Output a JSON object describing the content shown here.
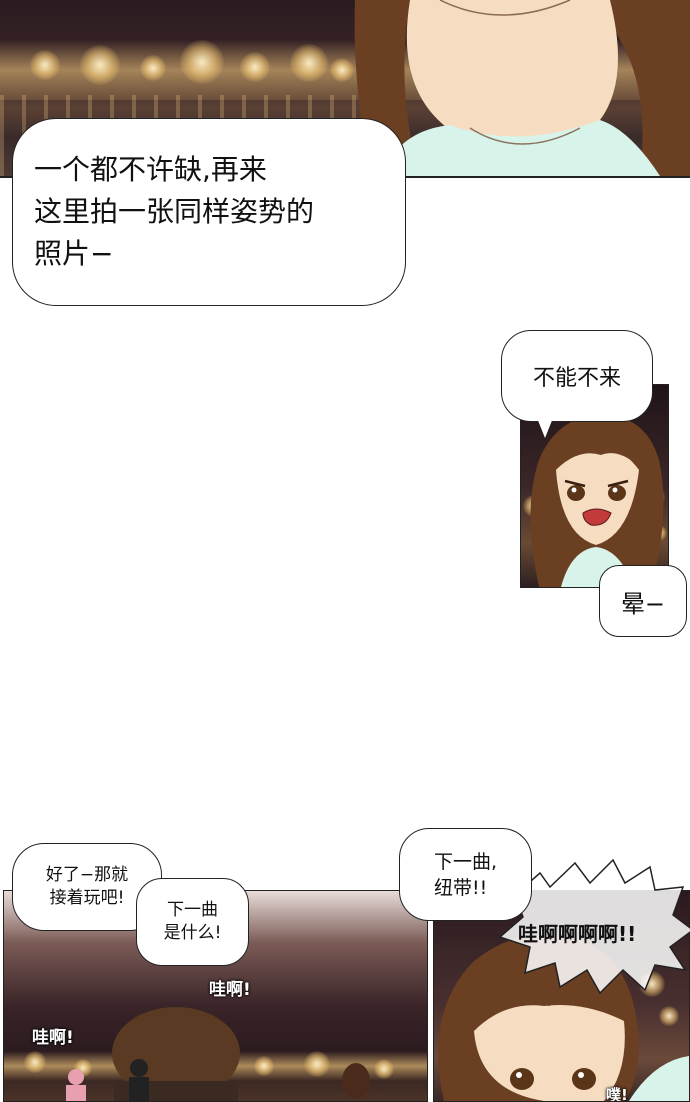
{
  "panels": {
    "top": {
      "bubble_text": "一个都不许缺,再来\n这里拍一张同样姿势的\n照片−"
    },
    "middle": {
      "bubble_text": "不能不来",
      "small_bubble_text": "晕−"
    },
    "bottom_left": {
      "bubble1_text": "好了−那就\n接着玩吧!",
      "bubble2_text": "下一曲\n是什么!",
      "sfx1": "哇啊!",
      "sfx2": "哇啊!"
    },
    "bottom_right": {
      "bubble_text": "下一曲,\n纽带!!",
      "shout_text": "哇啊啊啊啊!!",
      "sfx": "噗!"
    }
  },
  "colors": {
    "night_sky": "#2a1a1e",
    "hair": "#6b3f22",
    "skin": "#f6dcc0",
    "shirt": "#d8f3ea",
    "lights": "#ffd98a"
  }
}
